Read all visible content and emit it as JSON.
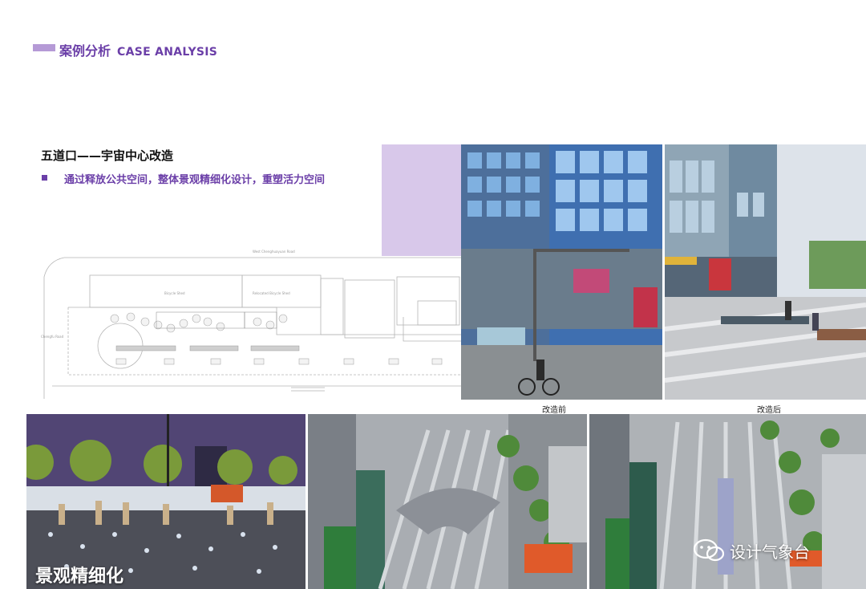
{
  "header": {
    "title_cn": "案例分析",
    "title_en": "CASE ANALYSIS"
  },
  "case": {
    "title": "五道口——宇宙中心改造",
    "bullet": "通过释放公共空间，整体景观精细化设计，重塑活力空间"
  },
  "plan": {
    "road_top": "West Chenghuayuan Road",
    "road_left": "Chengfu Road",
    "shed_left": "Bicycle Shed",
    "shed_right": "Relocated Bicycle Shed"
  },
  "captions": {
    "before": "改造前",
    "after": "改造后",
    "night": "景观精细化"
  },
  "watermark": {
    "text": "设计气象台",
    "icon": "wechat-icon"
  },
  "colors": {
    "accent": "#6b3fa8",
    "accent_light": "#b59ad6",
    "lilac_block": "#d8c8ea"
  }
}
